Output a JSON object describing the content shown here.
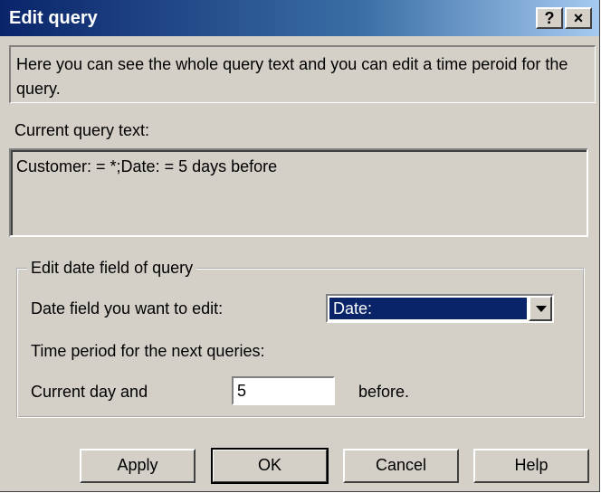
{
  "window": {
    "title": "Edit query",
    "help_button": "?",
    "close_button": "×"
  },
  "intro_text": "Here you can see the whole query text and you can edit a time peroid for the query.",
  "current_query": {
    "label": "Current query text:",
    "value": "Customer: = *;Date: = 5 days before"
  },
  "date_group": {
    "legend": "Edit date field of query",
    "date_field_label": "Date field you want to edit:",
    "date_field_value": "Date:",
    "period_label": "Time period for the next queries:",
    "current_day_label": "Current day and",
    "days_value": "5",
    "before_label": "before."
  },
  "buttons": {
    "apply": "Apply",
    "ok": "OK",
    "cancel": "Cancel",
    "help": "Help"
  }
}
